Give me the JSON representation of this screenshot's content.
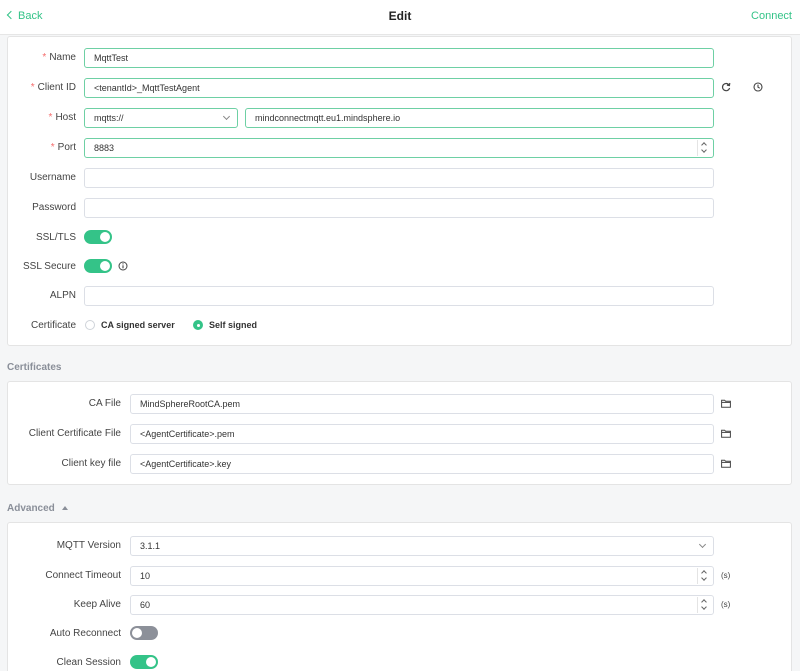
{
  "header": {
    "back_label": "Back",
    "title": "Edit",
    "connect_label": "Connect"
  },
  "general": {
    "name": {
      "label": "Name",
      "value": "MqttTest"
    },
    "client_id": {
      "label": "Client ID",
      "value": "<tenantId>_MqttTestAgent"
    },
    "host": {
      "label": "Host",
      "protocol": "mqtts://",
      "value": "mindconnectmqtt.eu1.mindsphere.io"
    },
    "port": {
      "label": "Port",
      "value": "8883"
    },
    "username": {
      "label": "Username",
      "value": ""
    },
    "password": {
      "label": "Password",
      "value": ""
    },
    "ssl_tls": {
      "label": "SSL/TLS",
      "on": true
    },
    "ssl_secure": {
      "label": "SSL Secure",
      "on": true
    },
    "alpn": {
      "label": "ALPN",
      "value": ""
    },
    "certificate": {
      "label": "Certificate",
      "options": [
        "CA signed server",
        "Self signed"
      ],
      "selected": "Self signed"
    }
  },
  "certificates": {
    "section_title": "Certificates",
    "ca_file": {
      "label": "CA File",
      "value": "MindSphereRootCA.pem"
    },
    "client_cert": {
      "label": "Client Certificate File",
      "value": "<AgentCertificate>.pem"
    },
    "client_key": {
      "label": "Client key file",
      "value": "<AgentCertificate>.key"
    }
  },
  "advanced": {
    "section_title": "Advanced",
    "mqtt_version": {
      "label": "MQTT Version",
      "value": "3.1.1"
    },
    "connect_timeout": {
      "label": "Connect Timeout",
      "value": "10",
      "unit": "(s)"
    },
    "keep_alive": {
      "label": "Keep Alive",
      "value": "60",
      "unit": "(s)"
    },
    "auto_reconnect": {
      "label": "Auto Reconnect",
      "on": false
    },
    "clean_session": {
      "label": "Clean Session",
      "on": true
    }
  },
  "colors": {
    "accent": "#34c388",
    "required": "#f56c6c",
    "toggle_off": "#8c9099"
  },
  "icons": [
    "chevron-left-icon",
    "refresh-icon",
    "clock-icon",
    "info-icon",
    "folder-icon",
    "chevron-down-icon",
    "caret-up-icon"
  ]
}
